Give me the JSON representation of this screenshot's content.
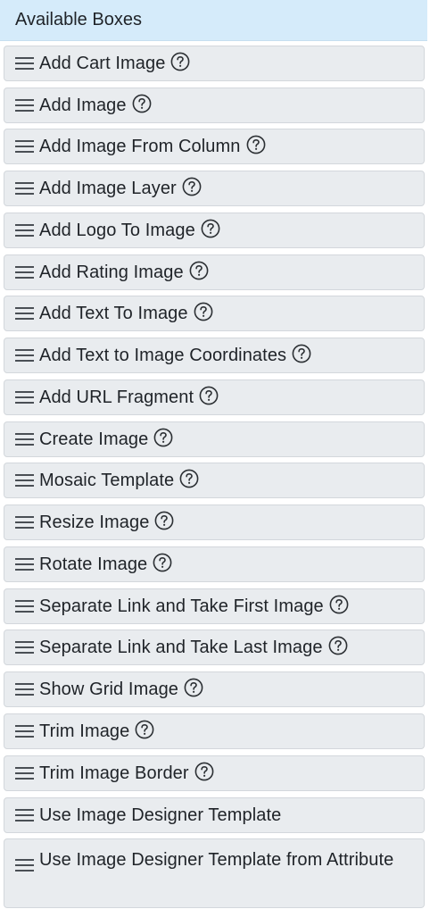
{
  "panel": {
    "title": "Available Boxes"
  },
  "icons": {
    "drag": "hamburger-drag-icon",
    "help": "question-circle-icon"
  },
  "colors": {
    "header_bg": "#d5ebfa",
    "item_bg": "#e9ecef",
    "item_border": "#d3d7dc",
    "text": "#1f2328"
  },
  "boxes": [
    {
      "label": "Add Cart Image",
      "has_help": true
    },
    {
      "label": "Add Image",
      "has_help": true
    },
    {
      "label": "Add Image From Column",
      "has_help": true
    },
    {
      "label": "Add Image Layer",
      "has_help": true
    },
    {
      "label": "Add Logo To Image",
      "has_help": true
    },
    {
      "label": "Add Rating Image",
      "has_help": true
    },
    {
      "label": "Add Text To Image",
      "has_help": true
    },
    {
      "label": "Add Text to Image Coordinates",
      "has_help": true
    },
    {
      "label": "Add URL Fragment",
      "has_help": true
    },
    {
      "label": "Create Image",
      "has_help": true
    },
    {
      "label": "Mosaic Template",
      "has_help": true
    },
    {
      "label": "Resize Image",
      "has_help": true
    },
    {
      "label": "Rotate Image",
      "has_help": true
    },
    {
      "label": "Separate Link and Take First Image",
      "has_help": true
    },
    {
      "label": "Separate Link and Take Last Image",
      "has_help": true
    },
    {
      "label": "Show Grid Image",
      "has_help": true
    },
    {
      "label": "Trim Image",
      "has_help": true
    },
    {
      "label": "Trim Image Border",
      "has_help": true
    },
    {
      "label": "Use Image Designer Template",
      "has_help": false
    },
    {
      "label": "Use Image Designer Template from Attribute",
      "has_help": false
    }
  ]
}
